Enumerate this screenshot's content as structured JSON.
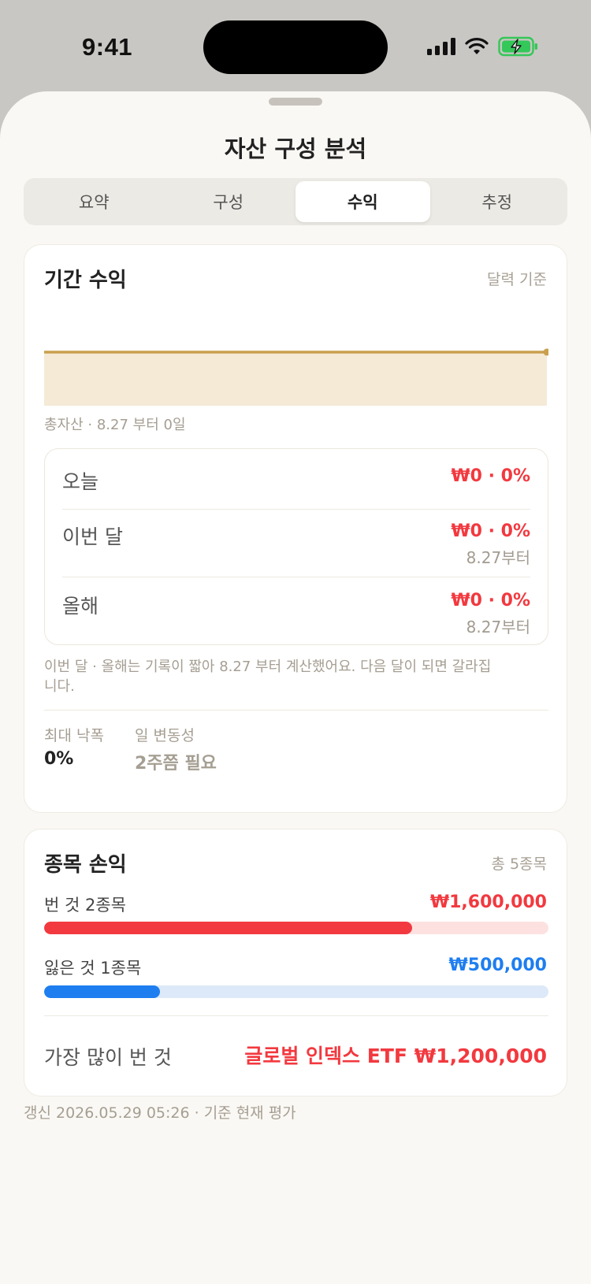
{
  "status_bar": {
    "time": "9:41"
  },
  "sheet": {
    "title": "자산 구성 분석"
  },
  "tabs": [
    {
      "label": "요약"
    },
    {
      "label": "구성"
    },
    {
      "label": "수익"
    },
    {
      "label": "추정"
    }
  ],
  "period_card": {
    "title": "기간 수익",
    "meta": "달력 기준",
    "caption": "총자산 · 8.27 부터 0일",
    "rows": [
      {
        "label": "오늘",
        "value": "₩0 · 0%",
        "sub": ""
      },
      {
        "label": "이번 달",
        "value": "₩0 · 0%",
        "sub": "8.27부터"
      },
      {
        "label": "올해",
        "value": "₩0 · 0%",
        "sub": "8.27부터"
      }
    ],
    "note": "이번 달 · 올해는 기록이 짧아 8.27 부터 계산했어요. 다음 달이 되면 갈라집니다.",
    "stats": {
      "max_drawdown_label": "최대 낙폭",
      "max_drawdown_value": "0%",
      "daily_vol_label": "일 변동성",
      "daily_vol_value": "2주쯤 필요"
    }
  },
  "chart_data": {
    "type": "area",
    "x": [
      0,
      1
    ],
    "values": [
      0,
      0
    ],
    "title": "",
    "xlabel": "",
    "ylabel": "",
    "grid": false
  },
  "holdings_card": {
    "title": "종목 손익",
    "meta": "총 5종목",
    "gain": {
      "label": "번 것 2종목",
      "amount": "₩1,600,000",
      "ratio": 0.73
    },
    "loss": {
      "label": "잃은 것 1종목",
      "amount": "₩500,000",
      "ratio": 0.23
    },
    "best_label": "가장 많이 번 것",
    "best_value": "글로벌 인덱스 ETF ₩1,200,000"
  },
  "colors": {
    "gain": "#f2393f",
    "gain_track": "#fde1e1",
    "loss": "#1e7ef0",
    "loss_track": "#dde9f8",
    "chart_line": "#c9a04e",
    "chart_fill": "#f4ead6"
  },
  "footer": {
    "text": "갱신 2026.05.29 05:26 · 기준 현재 평가"
  }
}
